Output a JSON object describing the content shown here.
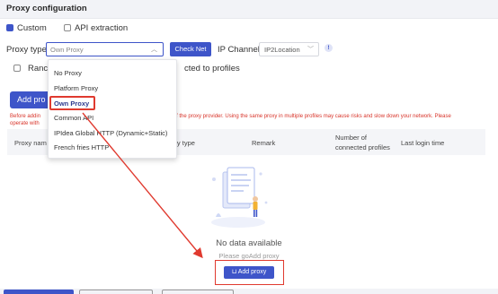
{
  "header": {
    "title": "Proxy configuration"
  },
  "mode": {
    "custom_label": "Custom",
    "api_label": "API extraction"
  },
  "proxy_type": {
    "label": "Proxy type",
    "selected": "Own Proxy",
    "check_button": "Check Net",
    "ip_channel_label": "IP Channel",
    "ip_channel_value": "IP2Location"
  },
  "random_row": {
    "label": "Ranc",
    "blank_text": "cted to profiles"
  },
  "add_button_top": "Add pro",
  "warning": {
    "line1_start": "Before addin",
    "line1_end": "s of the proxy provider. Using the same proxy in multiple profiles may cause risks and slow down your network. Please",
    "line2": "operate with"
  },
  "table": {
    "headers": [
      "Proxy nam",
      "oxy type",
      "Remark",
      "Number of",
      "connected profiles",
      "Last login time"
    ]
  },
  "dropdown": {
    "options": [
      "No Proxy",
      "Platform Proxy",
      "Own Proxy",
      "Common API",
      "IPIdea Global HTTP (Dynamic+Static)",
      "French fries HTTP"
    ]
  },
  "empty": {
    "title": "No data available",
    "subtitle": "Please goAdd proxy",
    "button": "Add proxy"
  },
  "colors": {
    "accent": "#3e55c9",
    "highlight": "#e03a2f",
    "warning": "#d8342a"
  }
}
